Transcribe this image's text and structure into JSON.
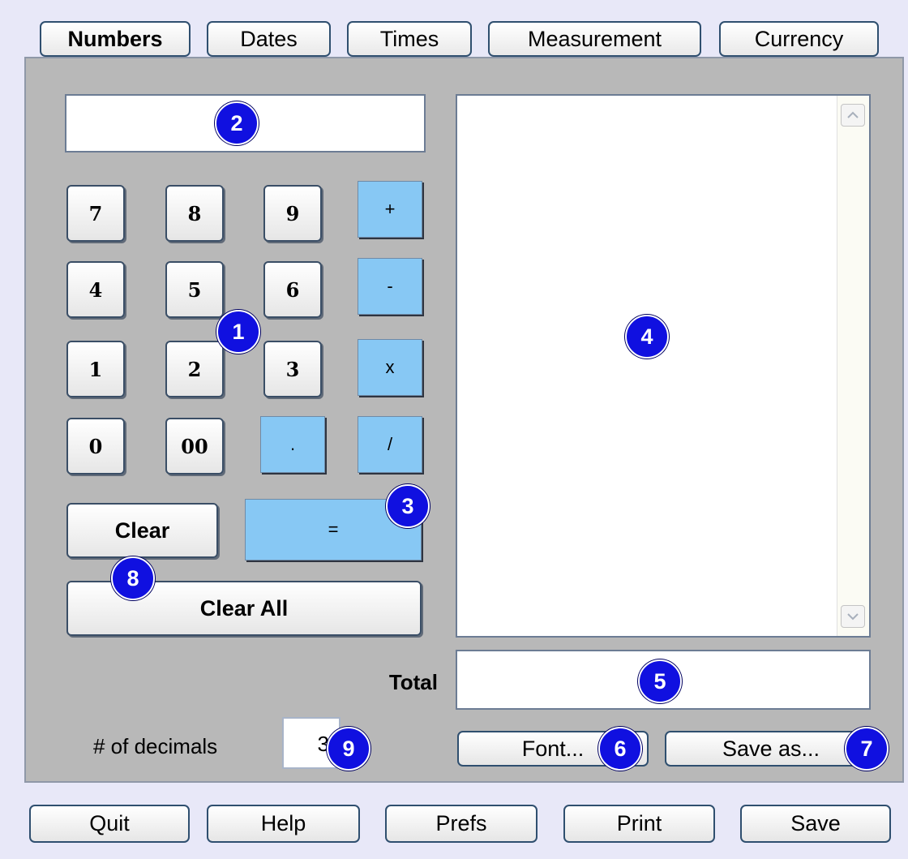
{
  "tabs": [
    "Numbers",
    "Dates",
    "Times",
    "Measurement",
    "Currency"
  ],
  "keypad": {
    "row1": [
      "7",
      "8",
      "9",
      "+"
    ],
    "row2": [
      "4",
      "5",
      "6",
      "-"
    ],
    "row3": [
      "1",
      "2",
      "3",
      "x"
    ],
    "row4": [
      "0",
      "00",
      ".",
      "/"
    ]
  },
  "buttons": {
    "clear": "Clear",
    "equals": "=",
    "clear_all": "Clear All",
    "font": "Font...",
    "save_as": "Save as..."
  },
  "labels": {
    "total": "Total",
    "decimals": "# of decimals"
  },
  "inputs": {
    "display": "",
    "total": "",
    "decimals": "3"
  },
  "bottom": [
    "Quit",
    "Help",
    "Prefs",
    "Print",
    "Save"
  ],
  "badges": [
    "1",
    "2",
    "3",
    "4",
    "5",
    "6",
    "7",
    "8",
    "9"
  ],
  "colors": {
    "background": "#e8e8f8",
    "panel": "#b8b8b8",
    "operator": "#87c8f4",
    "badge": "#1010e0"
  }
}
